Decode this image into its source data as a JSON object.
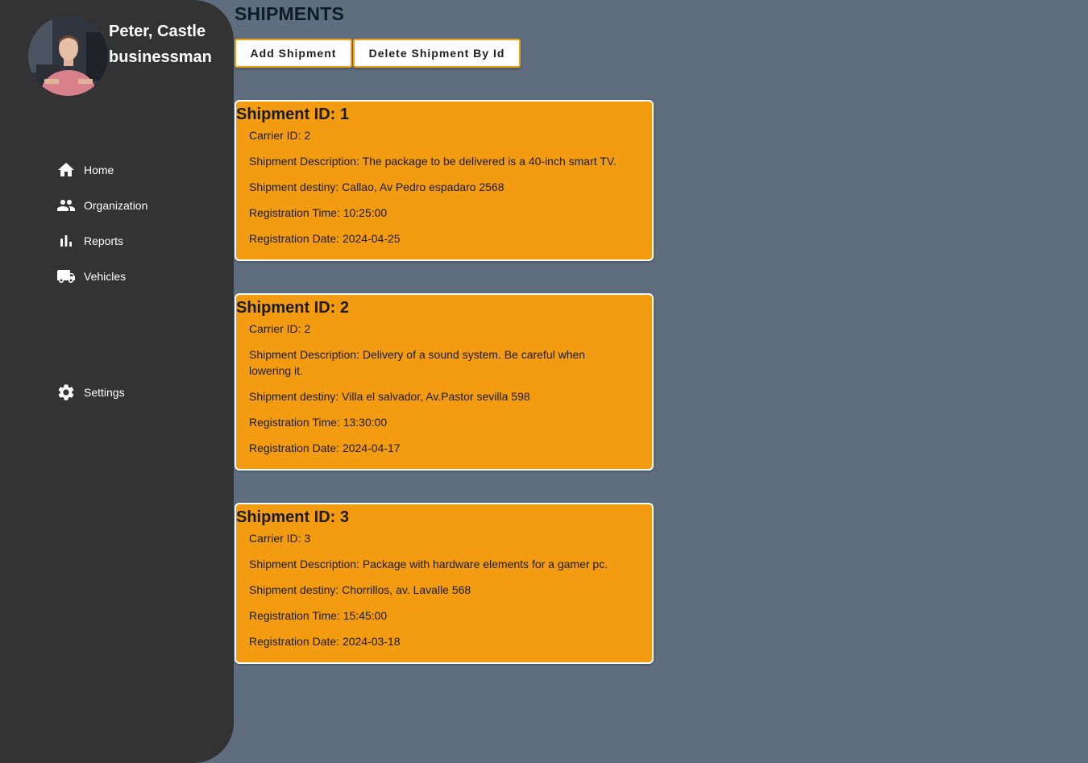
{
  "profile": {
    "name": "Peter, Castle",
    "role": "businessman"
  },
  "nav": {
    "home": "Home",
    "organization": "Organization",
    "reports": "Reports",
    "vehicles": "Vehicles",
    "settings": "Settings"
  },
  "page": {
    "title": "SHIPMENTS",
    "add_button": "Add Shipment",
    "delete_button": "Delete Shipment By Id"
  },
  "shipments": [
    {
      "title": "Shipment ID: 1",
      "carrier": "Carrier ID: 2",
      "description": "Shipment Description: The package to be delivered is a 40-inch smart TV.",
      "destiny": "Shipment destiny: Callao, Av Pedro espadaro 2568",
      "time": "Registration Time: 10:25:00",
      "date": "Registration Date: 2024-04-25"
    },
    {
      "title": "Shipment ID: 2",
      "carrier": "Carrier ID: 2",
      "description": "Shipment Description: Delivery of a sound system. Be careful when lowering it.",
      "destiny": "Shipment destiny: Villa el salvador, Av.Pastor sevilla 598",
      "time": "Registration Time: 13:30:00",
      "date": "Registration Date: 2024-04-17"
    },
    {
      "title": "Shipment ID: 3",
      "carrier": "Carrier ID: 3",
      "description": "Shipment Description: Package with hardware elements for a gamer pc.",
      "destiny": "Shipment destiny: Chorrillos, av. Lavalle 568",
      "time": "Registration Time: 15:45:00",
      "date": "Registration Date: 2024-03-18"
    }
  ],
  "colors": {
    "background": "#5f6e7f",
    "sidebar": "#333333",
    "card": "#f39c12",
    "accent_border": "#f19f12"
  }
}
